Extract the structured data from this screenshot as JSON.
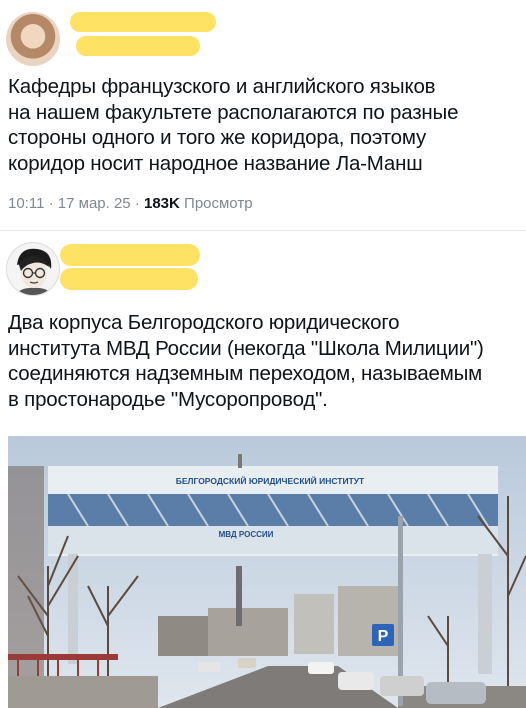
{
  "posts": [
    {
      "text": "Кафедры французского и английского языков\nна нашем факультете располагаются по разные\nстороны одного и того же коридора, поэтому\nкоридор носит народное название Ла-Манш",
      "time": "10:11",
      "date": "17 мар. 25",
      "views_count": "183K",
      "views_label": "Просмотр"
    },
    {
      "text": "Два корпуса Белгородского юридического\nинститута МВД России (некогда \"Школа Милиции\")\nсоединяются надземным переходом, называемым\nв простонародье \"Мусоропровод\".",
      "photo": {
        "sign_main": "БЕЛГОРОДСКИЙ ЮРИДИЧЕСКИЙ ИНСТИТУТ",
        "sign_sub": "МВД РОССИИ",
        "parking_sign": "P"
      }
    }
  ],
  "colors": {
    "redaction": "#fde263",
    "meta_gray": "#7f8891",
    "sky": "#c9d6e4"
  }
}
